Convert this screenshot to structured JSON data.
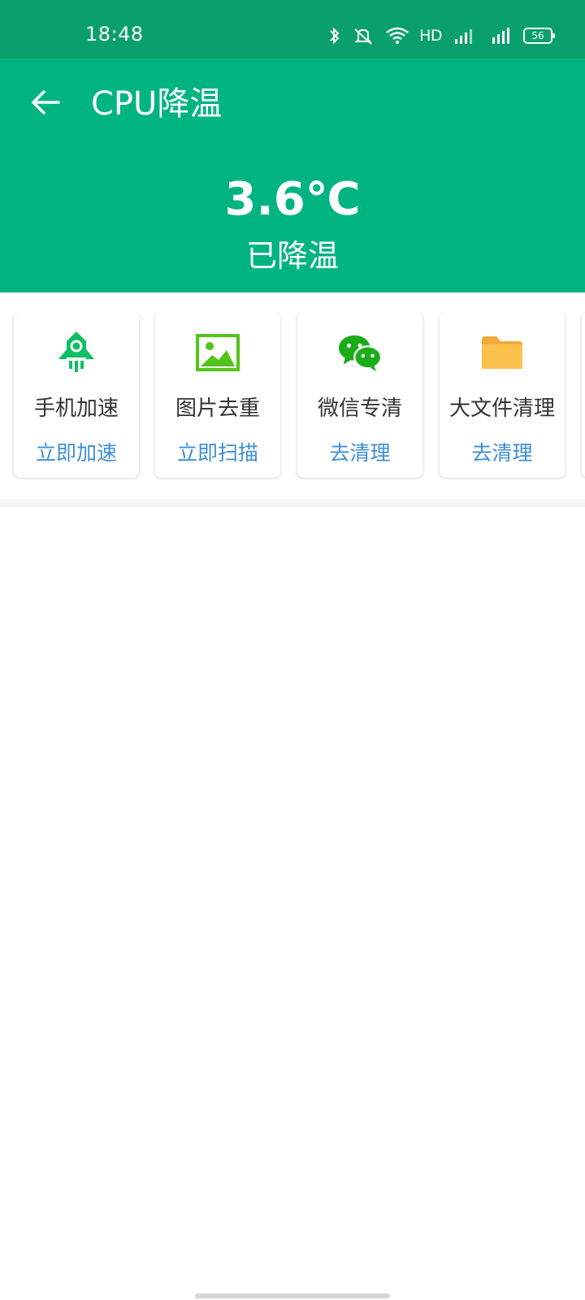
{
  "status_bar": {
    "time": "18:48",
    "network_label": "HD",
    "battery_level": "56",
    "icons": [
      "bluetooth-icon",
      "mute-icon",
      "wifi-icon",
      "signal-icon",
      "battery-icon"
    ]
  },
  "header": {
    "title": "CPU降温",
    "temperature": "3.6℃",
    "status": "已降温",
    "background_color": "#00b482",
    "status_bar_color": "#0aa06e"
  },
  "cards": [
    {
      "title": "手机加速",
      "action": "立即加速",
      "icon": "rocket-icon"
    },
    {
      "title": "图片去重",
      "action": "立即扫描",
      "icon": "image-icon"
    },
    {
      "title": "微信专清",
      "action": "去清理",
      "icon": "wechat-icon"
    },
    {
      "title": "大文件清理",
      "action": "去清理",
      "icon": "folder-icon"
    }
  ],
  "colors": {
    "action_text": "#3d8fd6",
    "card_title": "#333333",
    "green_icon": "#0fbf64"
  }
}
